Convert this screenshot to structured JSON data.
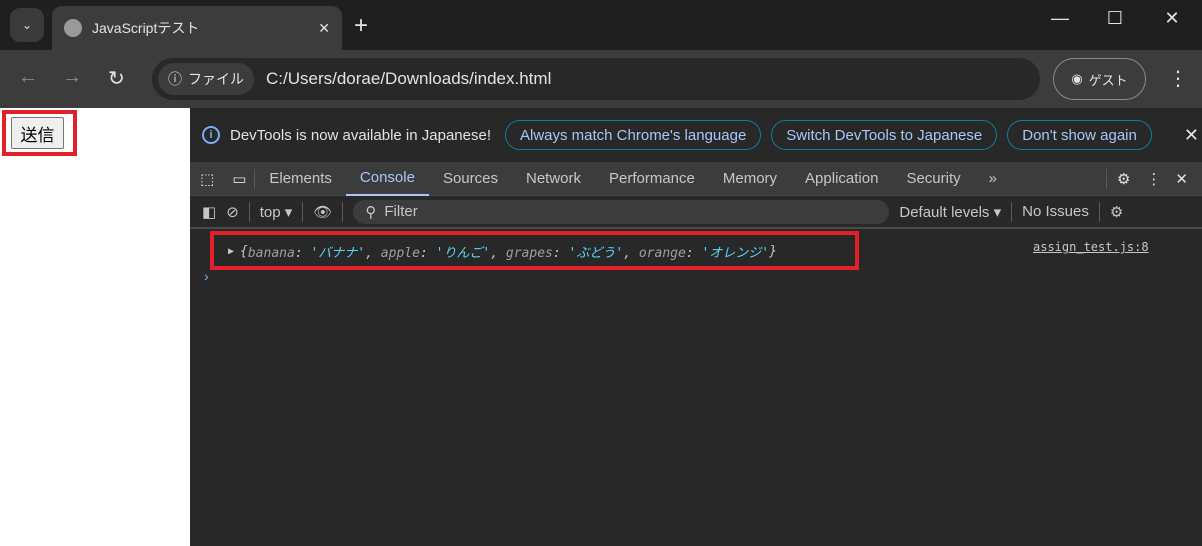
{
  "browser": {
    "tab_title": "JavaScriptテスト",
    "url_chip": "ファイル",
    "url": "C:/Users/dorae/Downloads/index.html",
    "profile": "ゲスト"
  },
  "page": {
    "button": "送信"
  },
  "devtools": {
    "infobar": {
      "message": "DevTools is now available in Japanese!",
      "buttons": [
        "Always match Chrome's language",
        "Switch DevTools to Japanese",
        "Don't show again"
      ]
    },
    "tabs": [
      "Elements",
      "Console",
      "Sources",
      "Network",
      "Performance",
      "Memory",
      "Application",
      "Security"
    ],
    "active_tab": "Console",
    "console_toolbar": {
      "context": "top",
      "filter_placeholder": "Filter",
      "levels": "Default levels",
      "issues": "No Issues"
    },
    "log": {
      "source": "assign_test.js:8",
      "entries": [
        {
          "key": "banana",
          "value": "'バナナ'"
        },
        {
          "key": "apple",
          "value": "'りんご'"
        },
        {
          "key": "grapes",
          "value": "'ぶどう'"
        },
        {
          "key": "orange",
          "value": "'オレンジ'"
        }
      ]
    }
  },
  "colors": {
    "highlight": "#e2202a",
    "accent": "#a8c7fa"
  }
}
